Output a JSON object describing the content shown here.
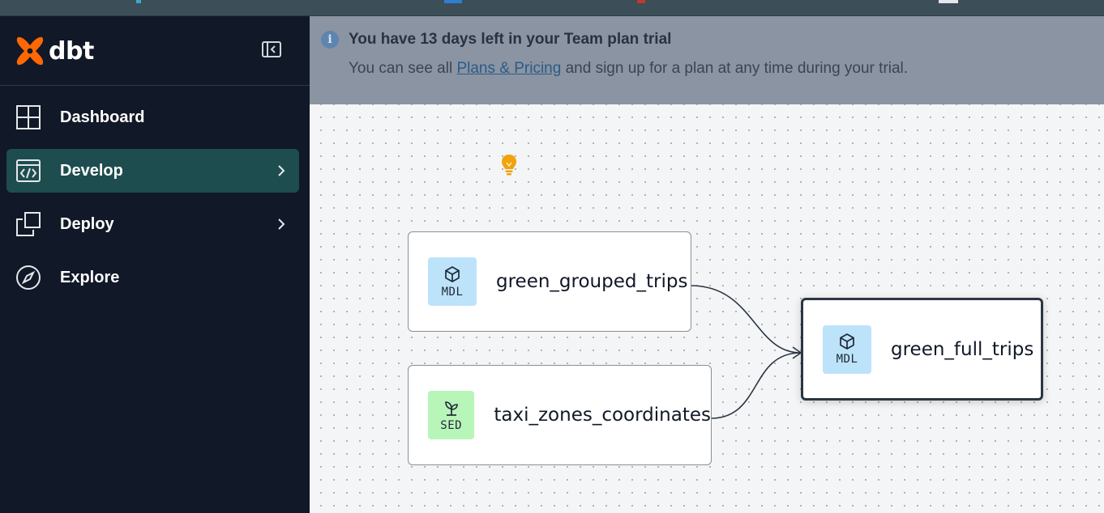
{
  "app": {
    "brand": "dbt",
    "accent_color": "#fe6703",
    "active_color": "#1e4d4f"
  },
  "sidebar": {
    "collapse_icon": "sidebar-collapse-icon",
    "items": [
      {
        "label": "Dashboard",
        "icon": "dashboard-icon",
        "active": false,
        "has_submenu": false
      },
      {
        "label": "Develop",
        "icon": "code-icon",
        "active": true,
        "has_submenu": true
      },
      {
        "label": "Deploy",
        "icon": "deploy-icon",
        "active": false,
        "has_submenu": true
      },
      {
        "label": "Explore",
        "icon": "compass-icon",
        "active": false,
        "has_submenu": false
      }
    ]
  },
  "banner": {
    "title": "You have 13 days left in your Team plan trial",
    "body_prefix": "You can see all ",
    "link_text": "Plans & Pricing",
    "body_suffix": " and sign up for a plan at any time during your trial."
  },
  "lineage": {
    "nodes": [
      {
        "label": "green_grouped_trips",
        "type": "MDL",
        "icon": "cube-icon",
        "selected": false
      },
      {
        "label": "taxi_zones_coordinates",
        "type": "SED",
        "icon": "seed-icon",
        "selected": false
      },
      {
        "label": "green_full_trips",
        "type": "MDL",
        "icon": "cube-icon",
        "selected": true
      }
    ],
    "edges": [
      {
        "from": "green_grouped_trips",
        "to": "green_full_trips"
      },
      {
        "from": "taxi_zones_coordinates",
        "to": "green_full_trips"
      }
    ],
    "hint_icon": "lightbulb-icon"
  }
}
